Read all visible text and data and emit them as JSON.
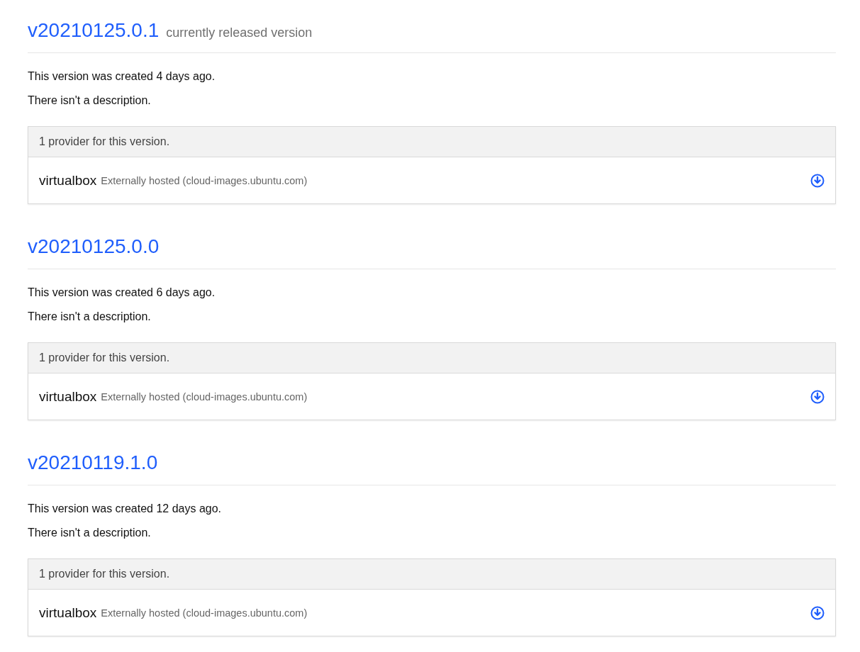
{
  "versions": [
    {
      "version": "v20210125.0.1",
      "note": "currently released version",
      "created": "This version was created 4 days ago.",
      "description": "There isn't a description.",
      "providers_header": "1 provider for this version.",
      "providers": [
        {
          "name": "virtualbox",
          "hosting": "Externally hosted (cloud-images.ubuntu.com)"
        }
      ]
    },
    {
      "version": "v20210125.0.0",
      "created": "This version was created 6 days ago.",
      "description": "There isn't a description.",
      "providers_header": "1 provider for this version.",
      "providers": [
        {
          "name": "virtualbox",
          "hosting": "Externally hosted (cloud-images.ubuntu.com)"
        }
      ]
    },
    {
      "version": "v20210119.1.0",
      "created": "This version was created 12 days ago.",
      "description": "There isn't a description.",
      "providers_header": "1 provider for this version.",
      "providers": [
        {
          "name": "virtualbox",
          "hosting": "Externally hosted (cloud-images.ubuntu.com)"
        }
      ]
    }
  ]
}
